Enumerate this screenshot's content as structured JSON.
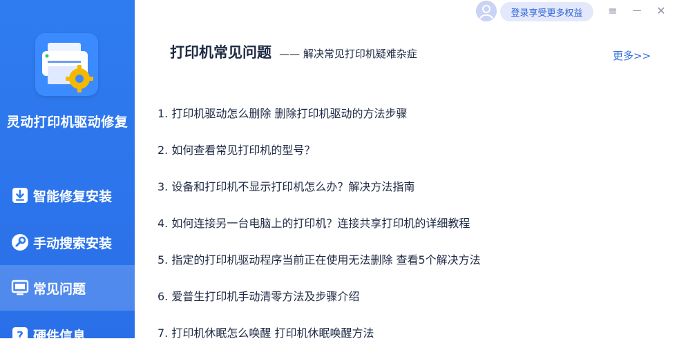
{
  "app": {
    "name": "灵动打印机驱动修复"
  },
  "sidebar": {
    "items": [
      {
        "label": "智能修复安装",
        "icon": "download-box-icon",
        "active": false
      },
      {
        "label": "手动搜索安装",
        "icon": "wrench-icon",
        "active": false
      },
      {
        "label": "常见问题",
        "icon": "monitor-icon",
        "active": true
      },
      {
        "label": "硬件信息",
        "icon": "question-icon",
        "active": false
      }
    ]
  },
  "topbar": {
    "login_label": "登录享受更多权益",
    "menu_glyph": "≡",
    "minimize_glyph": "—",
    "close_glyph": "✕"
  },
  "section": {
    "title": "打印机常见问题",
    "subtitle": "—— 解决常见打印机疑难杂症",
    "more_label": "更多>>"
  },
  "faq": [
    "1. 打印机驱动怎么删除 删除打印机驱动的方法步骤",
    "2. 如何查看常见打印机的型号？",
    "3. 设备和打印机不显示打印机怎么办？解决方法指南",
    "4. 如何连接另一台电脑上的打印机？连接共享打印机的详细教程",
    "5. 指定的打印机驱动程序当前正在使用无法删除 查看5个解决方法",
    "6. 爱普生打印机手动清零方法及步骤介绍",
    "7. 打印机休眠怎么唤醒 打印机休眠唤醒方法"
  ],
  "colors": {
    "sidebar": "#2f7cf0",
    "accent": "#2f6fe0",
    "gear": "#f5b800"
  }
}
